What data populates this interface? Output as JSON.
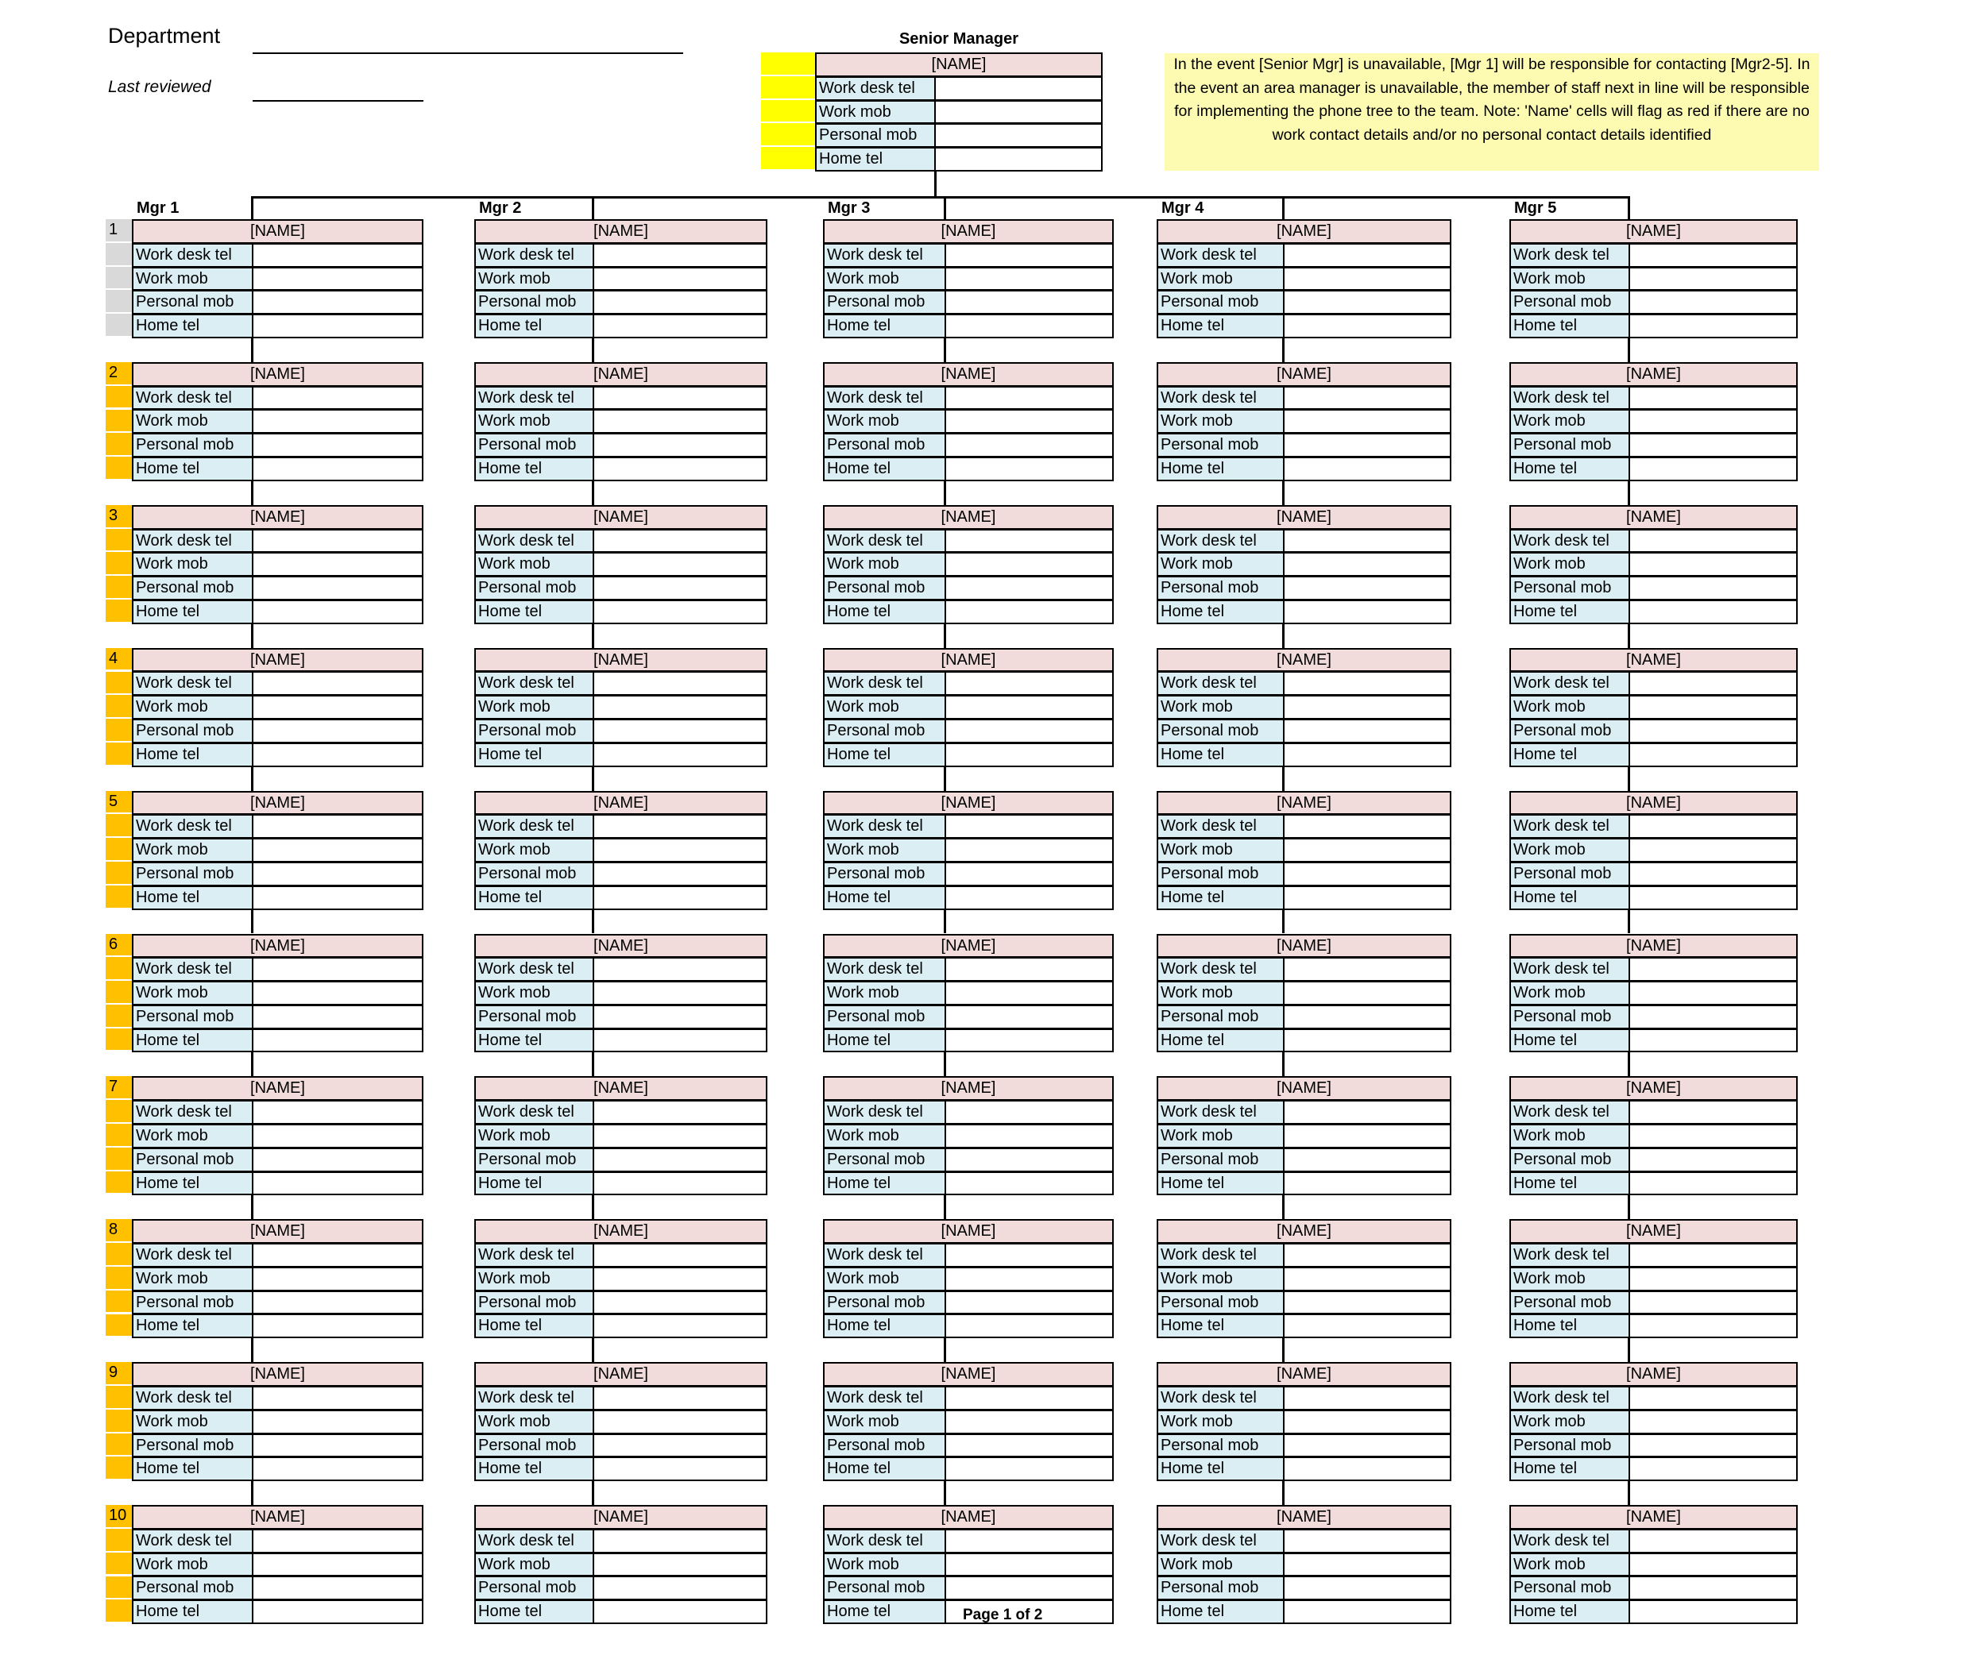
{
  "header": {
    "department_label": "Department",
    "department_value": "",
    "last_reviewed_label": "Last reviewed",
    "last_reviewed_value": ""
  },
  "senior_manager": {
    "title": "Senior Manager",
    "name": "[NAME]",
    "fields": [
      {
        "label": "Work desk tel",
        "value": ""
      },
      {
        "label": "Work mob",
        "value": ""
      },
      {
        "label": "Personal mob",
        "value": ""
      },
      {
        "label": "Home tel",
        "value": ""
      }
    ]
  },
  "note": "In the event [Senior Mgr] is unavailable, [Mgr 1] will be responsible for contacting [Mgr2-5]. In the event an area manager is unavailable, the member of staff next in line will be responsible for implementing the phone tree to the team. Note: 'Name' cells will flag as red if there are no work contact details and/or no personal contact details identified",
  "field_labels": [
    "Work desk tel",
    "Work mob",
    "Personal mob",
    "Home tel"
  ],
  "name_placeholder": "[NAME]",
  "row_numbers": [
    "1",
    "2",
    "3",
    "4",
    "5",
    "6",
    "7",
    "8",
    "9",
    "10"
  ],
  "managers": [
    {
      "title": "Mgr 1"
    },
    {
      "title": "Mgr 2"
    },
    {
      "title": "Mgr 3"
    },
    {
      "title": "Mgr 4"
    },
    {
      "title": "Mgr 5"
    }
  ],
  "colors": {
    "name_fill": "#f2dcdb",
    "label_fill": "#daeef3",
    "row_marker_first": "#d9d9d9",
    "row_marker_rest": "#ffc000",
    "senior_marker": "#ffff00",
    "note_fill": "#fdfbb1"
  },
  "footer": {
    "page_label": "Page 1 of 2"
  }
}
